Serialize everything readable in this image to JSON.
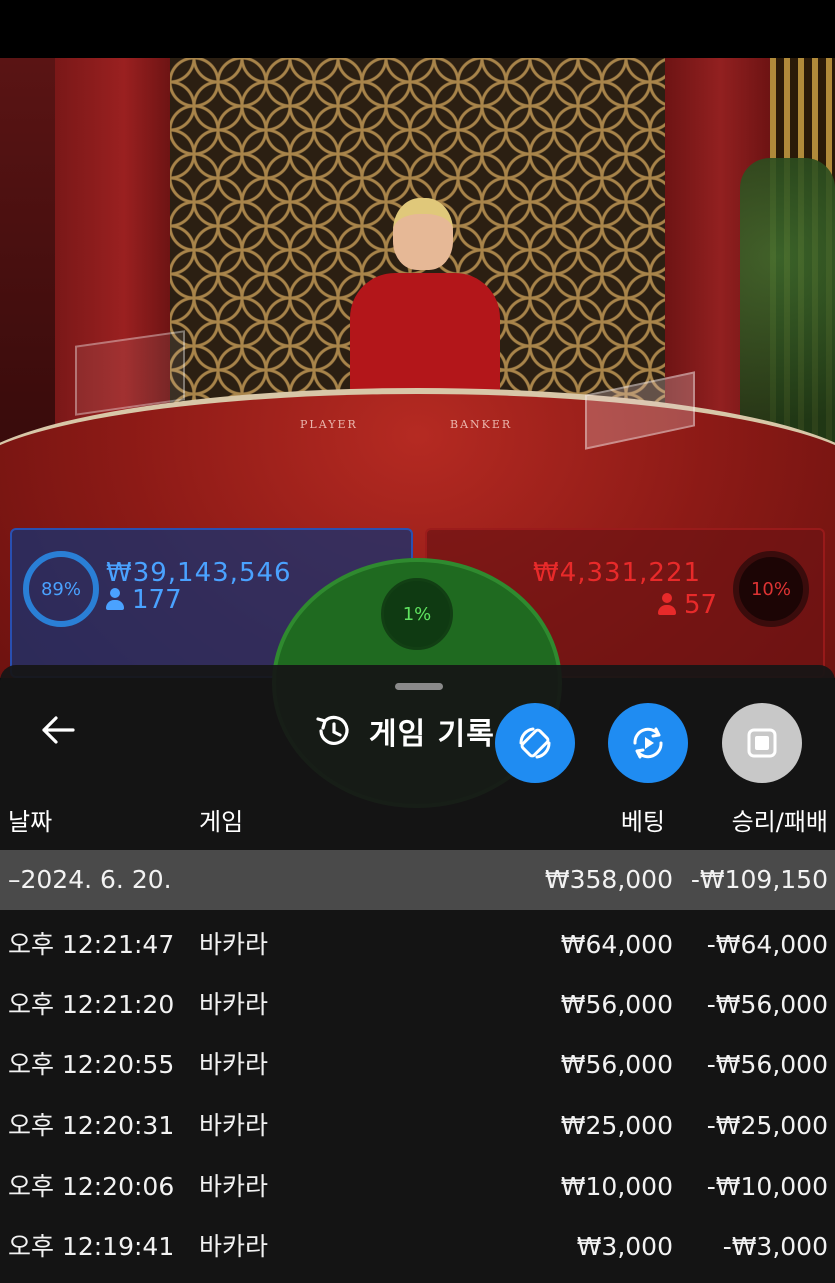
{
  "table": {
    "player_label": "PLAYER",
    "banker_label": "BANKER",
    "player_pct": "89%",
    "player_amount": "₩39,143,546",
    "player_count": "177",
    "banker_pct": "10%",
    "banker_amount": "₩4,331,221",
    "banker_count": "57",
    "tie_pct": "1%"
  },
  "sheet": {
    "title": "게임 기록",
    "columns": {
      "date": "날짜",
      "game": "게임",
      "bet": "베팅",
      "result": "승리/패배"
    },
    "date_group": {
      "date": "–2024. 6. 20.",
      "bet": "₩358,000",
      "result": "-₩109,150"
    },
    "rows": [
      {
        "time": "오후 12:21:47",
        "game": "바카라",
        "bet": "₩64,000",
        "result": "-₩64,000"
      },
      {
        "time": "오후 12:21:20",
        "game": "바카라",
        "bet": "₩56,000",
        "result": "-₩56,000"
      },
      {
        "time": "오후 12:20:55",
        "game": "바카라",
        "bet": "₩56,000",
        "result": "-₩56,000"
      },
      {
        "time": "오후 12:20:31",
        "game": "바카라",
        "bet": "₩25,000",
        "result": "-₩25,000"
      },
      {
        "time": "오후 12:20:06",
        "game": "바카라",
        "bet": "₩10,000",
        "result": "-₩10,000"
      },
      {
        "time": "오후 12:19:41",
        "game": "바카라",
        "bet": "₩3,000",
        "result": "-₩3,000"
      }
    ]
  },
  "icons": {
    "back": "arrow-left-icon",
    "history": "history-icon",
    "rotate": "rotate-icon",
    "replay": "replay-icon",
    "stop": "stop-icon"
  },
  "colors": {
    "player_blue": "#4aa2ff",
    "banker_red": "#e82a2a",
    "tie_green": "#5fe25f",
    "button_blue": "#1f8cf2"
  }
}
